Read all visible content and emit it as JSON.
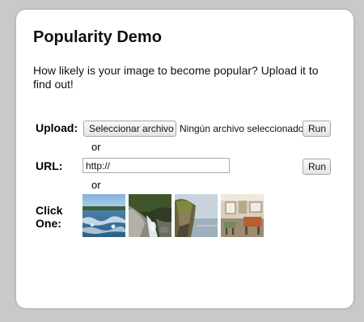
{
  "page": {
    "title": "Popularity Demo",
    "intro": "How likely is your image to become popular? Upload it to find out!"
  },
  "upload": {
    "label": "Upload:",
    "choose_button": "Seleccionar archivo",
    "file_status": "Ningún archivo seleccionado",
    "run_button": "Run"
  },
  "separator_1": "or",
  "url": {
    "label": "URL:",
    "value": "http://",
    "run_button": "Run"
  },
  "separator_2": "or",
  "click_one": {
    "label_line1": "Click",
    "label_line2": "One:"
  },
  "samples": [
    {
      "name": "river-rapids-image"
    },
    {
      "name": "stream-rocks-image"
    },
    {
      "name": "sea-cliff-image"
    },
    {
      "name": "room-interior-image"
    }
  ],
  "colors": {
    "page_background": "#c9c9c9",
    "card_background": "#ffffff",
    "text": "#111111"
  }
}
